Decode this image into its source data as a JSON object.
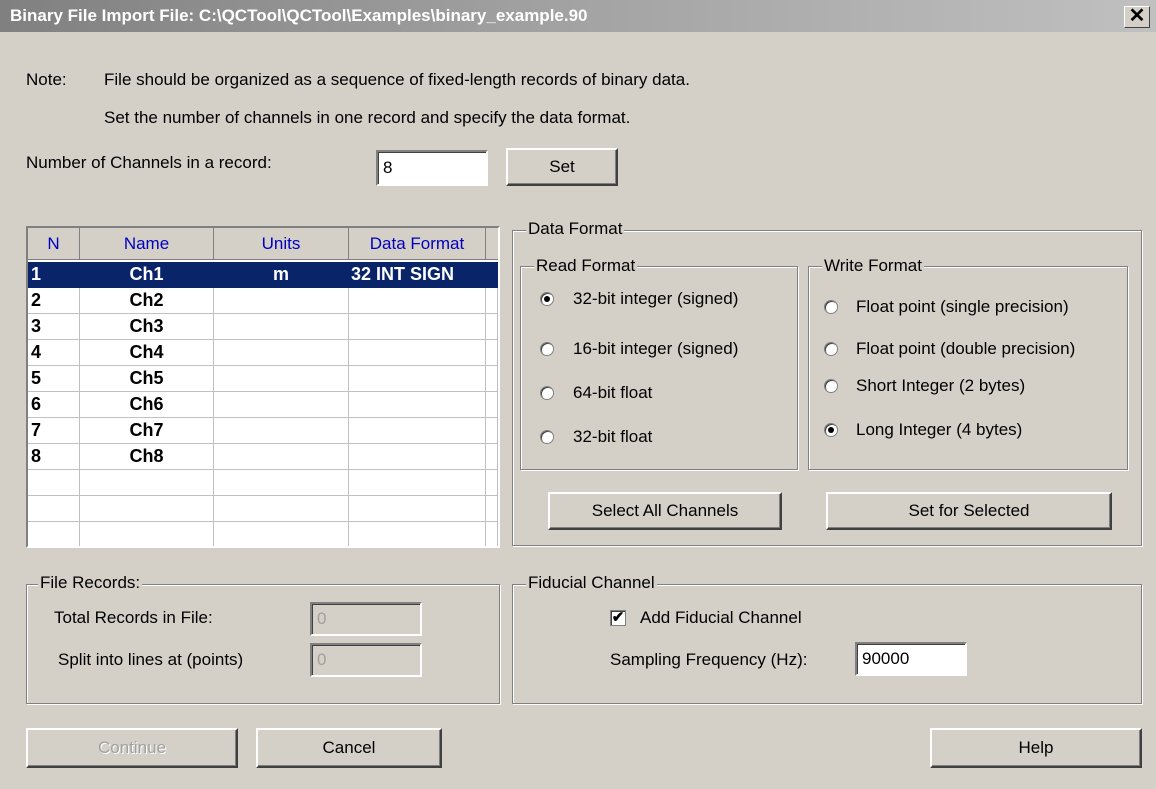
{
  "window": {
    "title": "Binary File Import   File: C:\\QCTool\\QCTool\\Examples\\binary_example.90",
    "close_glyph": "✕"
  },
  "note": {
    "label": "Note:",
    "line1": "File should be organized as a sequence of fixed-length records of binary data.",
    "line2": "Set the number of channels in one record and specify the data format."
  },
  "channels_count": {
    "label": "Number of Channels in a record:",
    "value": "8",
    "set_label": "Set"
  },
  "table": {
    "columns": [
      "N",
      "Name",
      "Units",
      "Data Format"
    ],
    "rows": [
      {
        "n": "1",
        "name": "Ch1",
        "units": "m",
        "format": "32 INT SIGN",
        "selected": true
      },
      {
        "n": "2",
        "name": "Ch2",
        "units": "",
        "format": ""
      },
      {
        "n": "3",
        "name": "Ch3",
        "units": "",
        "format": ""
      },
      {
        "n": "4",
        "name": "Ch4",
        "units": "",
        "format": ""
      },
      {
        "n": "5",
        "name": "Ch5",
        "units": "",
        "format": ""
      },
      {
        "n": "6",
        "name": "Ch6",
        "units": "",
        "format": ""
      },
      {
        "n": "7",
        "name": "Ch7",
        "units": "",
        "format": ""
      },
      {
        "n": "8",
        "name": "Ch8",
        "units": "",
        "format": ""
      }
    ]
  },
  "data_format": {
    "label": "Data Format",
    "read": {
      "label": "Read Format",
      "options": [
        "32-bit integer (signed)",
        "16-bit integer (signed)",
        "64-bit float",
        "32-bit float"
      ],
      "selected": 0
    },
    "write": {
      "label": "Write Format",
      "options": [
        "Float point (single precision)",
        "Float point (double precision)",
        "Short Integer (2 bytes)",
        "Long Integer (4 bytes)"
      ],
      "selected": 3
    },
    "select_all_label": "Select All Channels",
    "set_selected_label": "Set for Selected"
  },
  "file_records": {
    "label": "File Records:",
    "total_label": "Total Records in File:",
    "total_value": "0",
    "split_label": "Split into lines at (points)",
    "split_value": "0"
  },
  "fiducial": {
    "label": "Fiducial Channel",
    "add_label": "Add Fiducial Channel",
    "add_checked": true,
    "check_glyph": "✔",
    "freq_label": "Sampling Frequency (Hz):",
    "freq_value": "90000"
  },
  "buttons": {
    "continue": "Continue",
    "cancel": "Cancel",
    "help": "Help"
  }
}
